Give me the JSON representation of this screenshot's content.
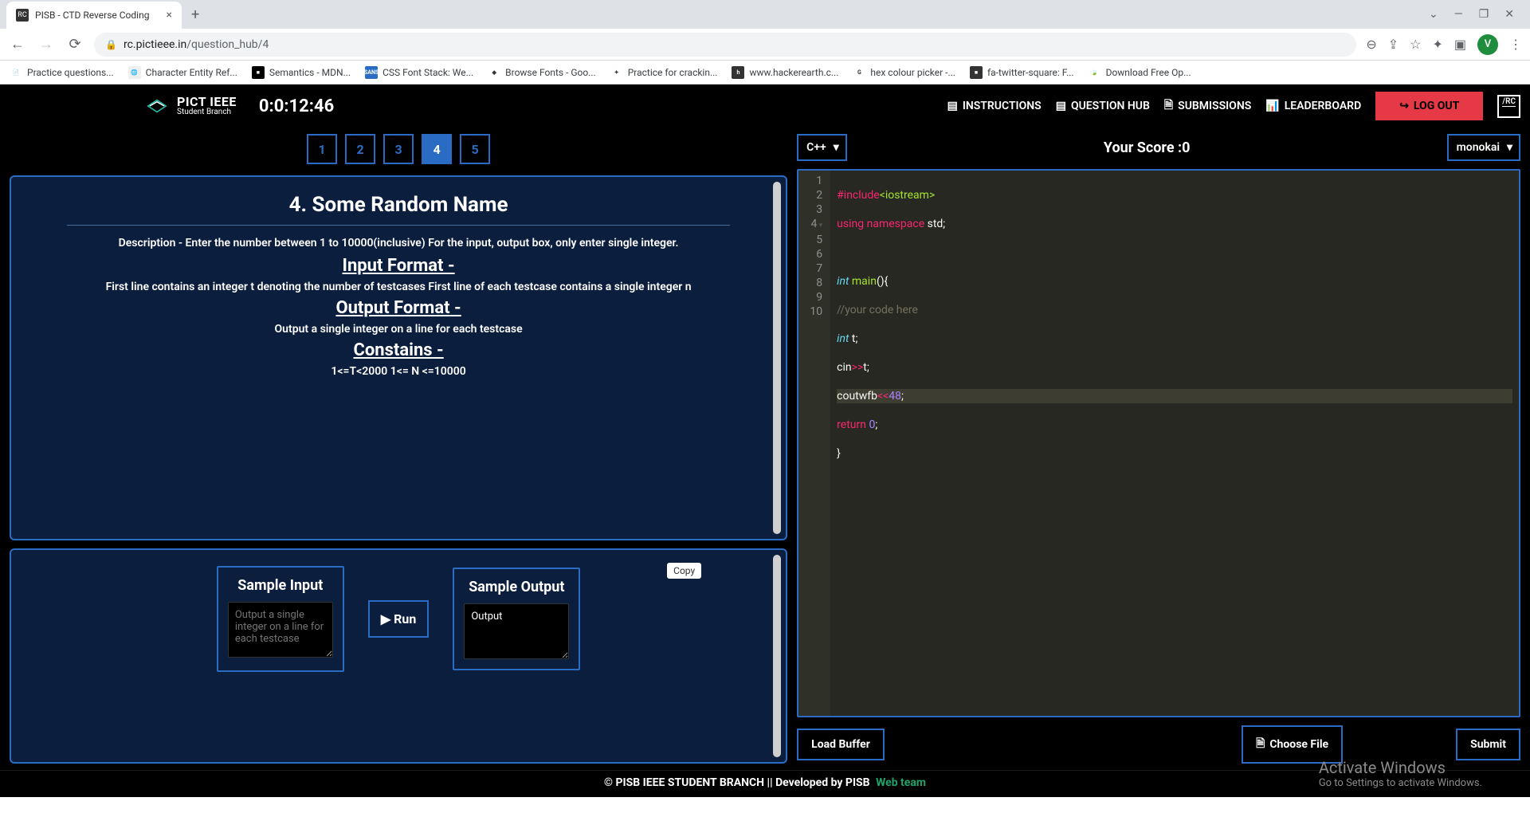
{
  "browser": {
    "tab_title": "PISB - CTD Reverse Coding",
    "url_host": "rc.pictieee.in",
    "url_path": "/question_hub/4",
    "avatar_letter": "V"
  },
  "bookmarks": [
    {
      "label": "Practice questions...",
      "icon": "📄",
      "bg": "#fff"
    },
    {
      "label": "Character Entity Ref...",
      "icon": "🌐",
      "bg": "#efefef"
    },
    {
      "label": "Semantics - MDN...",
      "icon": "■",
      "bg": "#000"
    },
    {
      "label": "CSS Font Stack: We...",
      "icon": "SANS",
      "bg": "#2a6cc4"
    },
    {
      "label": "Browse Fonts - Goo...",
      "icon": "◆",
      "bg": "#fff"
    },
    {
      "label": "Practice for crackin...",
      "icon": "✦",
      "bg": "#fff"
    },
    {
      "label": "www.hackerearth.c...",
      "icon": "h",
      "bg": "#333"
    },
    {
      "label": "hex colour picker -...",
      "icon": "G",
      "bg": "#fff"
    },
    {
      "label": "fa-twitter-square: F...",
      "icon": "■",
      "bg": "#333"
    },
    {
      "label": "Download Free Op...",
      "icon": "🍃",
      "bg": "#fff"
    }
  ],
  "header": {
    "logo_main": "PICT IEEE",
    "logo_sub": "Student Branch",
    "timer": "0:0:12:46",
    "nav": {
      "instructions": "INSTRUCTIONS",
      "question_hub": "QUESTION HUB",
      "submissions": "SUBMISSIONS",
      "leaderboard": "LEADERBOARD",
      "logout": "LOG OUT"
    },
    "rc_badge": "RC"
  },
  "questions": [
    "1",
    "2",
    "3",
    "4",
    "5"
  ],
  "active_question": "4",
  "problem": {
    "title": "4. Some Random Name",
    "description": "Description - Enter the number between 1 to 10000(inclusive) For the input, output box, only enter single integer.",
    "input_format_head": "Input Format",
    "input_format_text": "First line contains an integer t denoting the number of testcases First line of each testcase contains a single integer n",
    "output_format_head": "Output Format",
    "output_format_text": "Output a single integer on a line for each testcase",
    "constraints_head": "Constains",
    "constraints_text": "1<=T<2000 1<= N <=10000"
  },
  "sample": {
    "input_label": "Sample Input",
    "input_placeholder": "Output a single integer on a line for each testcase",
    "output_label": "Sample Output",
    "output_value": "Output",
    "run_label": "Run",
    "copy_label": "Copy"
  },
  "editor": {
    "language": "C++",
    "score_label": "Your Score :",
    "score_value": "0",
    "theme": "monokai",
    "lines": [
      "1",
      "2",
      "3",
      "4",
      "5",
      "6",
      "7",
      "8",
      "9",
      "10"
    ],
    "load_buffer": "Load Buffer",
    "choose_file": "Choose File",
    "submit": "Submit"
  },
  "activate": {
    "title": "Activate Windows",
    "sub": "Go to Settings to activate Windows."
  },
  "footer": {
    "text": "© PISB IEEE STUDENT BRANCH || Developed by PISB",
    "link": "Web team"
  }
}
